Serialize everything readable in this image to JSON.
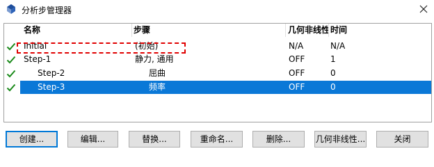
{
  "window": {
    "title": "分析步管理器"
  },
  "table": {
    "columns": [
      "名称",
      "步骤",
      "几何非线性",
      "时间"
    ],
    "rows": [
      {
        "name": "Initial",
        "procedure": "(初始)",
        "nlgeom": "N/A",
        "time": "N/A",
        "status": "checked",
        "selected": false
      },
      {
        "name": "Step-1",
        "procedure": "静力, 通用",
        "nlgeom": "OFF",
        "time": "1",
        "status": "checked",
        "selected": false
      },
      {
        "name": "Step-2",
        "procedure": "屈曲",
        "nlgeom": "OFF",
        "time": "0",
        "status": "checked",
        "selected": false
      },
      {
        "name": "Step-3",
        "procedure": "频率",
        "nlgeom": "OFF",
        "time": "0",
        "status": "checked",
        "selected": true
      }
    ]
  },
  "buttons": {
    "create": "创建...",
    "edit": "编辑...",
    "replace": "替换...",
    "rename": "重命名...",
    "delete": "删除...",
    "nlgeom": "几何非线性...",
    "close": "关闭"
  },
  "colors": {
    "selection": "#0a78d7",
    "check": "#1a8a1a",
    "annotation": "#e00000",
    "default_button_border": "#0078d7"
  },
  "icons": {
    "app": "abaqus-app-icon",
    "close": "close-icon",
    "status": "checkmark-icon"
  }
}
